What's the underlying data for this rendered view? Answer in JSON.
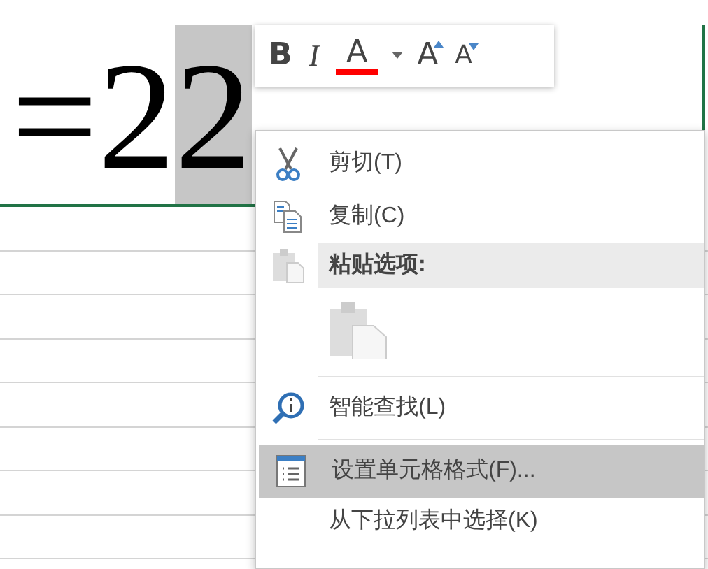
{
  "cell": {
    "segments": [
      {
        "text": "=2",
        "selected": false
      },
      {
        "text": "2",
        "selected": true
      }
    ]
  },
  "mini_toolbar": {
    "buttons": [
      {
        "kind": "bold",
        "label": "B"
      },
      {
        "kind": "italic",
        "label": "I"
      },
      {
        "kind": "font-color",
        "label": "A",
        "color": "#ff0000"
      },
      {
        "kind": "dropdown"
      },
      {
        "kind": "grow",
        "label": "A"
      },
      {
        "kind": "shrink",
        "label": "A"
      }
    ]
  },
  "context_menu": {
    "items": [
      {
        "kind": "command",
        "label": "剪切(T)",
        "selected": false
      },
      {
        "kind": "command",
        "label": "复制(C)",
        "selected": false
      },
      {
        "kind": "header",
        "label": "粘贴选项:"
      },
      {
        "kind": "paste-button"
      },
      {
        "kind": "separator"
      },
      {
        "kind": "command",
        "label": "智能查找(L)",
        "selected": false
      },
      {
        "kind": "separator"
      },
      {
        "kind": "command",
        "label": "设置单元格格式(F)...",
        "selected": true
      },
      {
        "kind": "command",
        "label": "从下拉列表中选择(K)",
        "selected": false
      }
    ]
  }
}
